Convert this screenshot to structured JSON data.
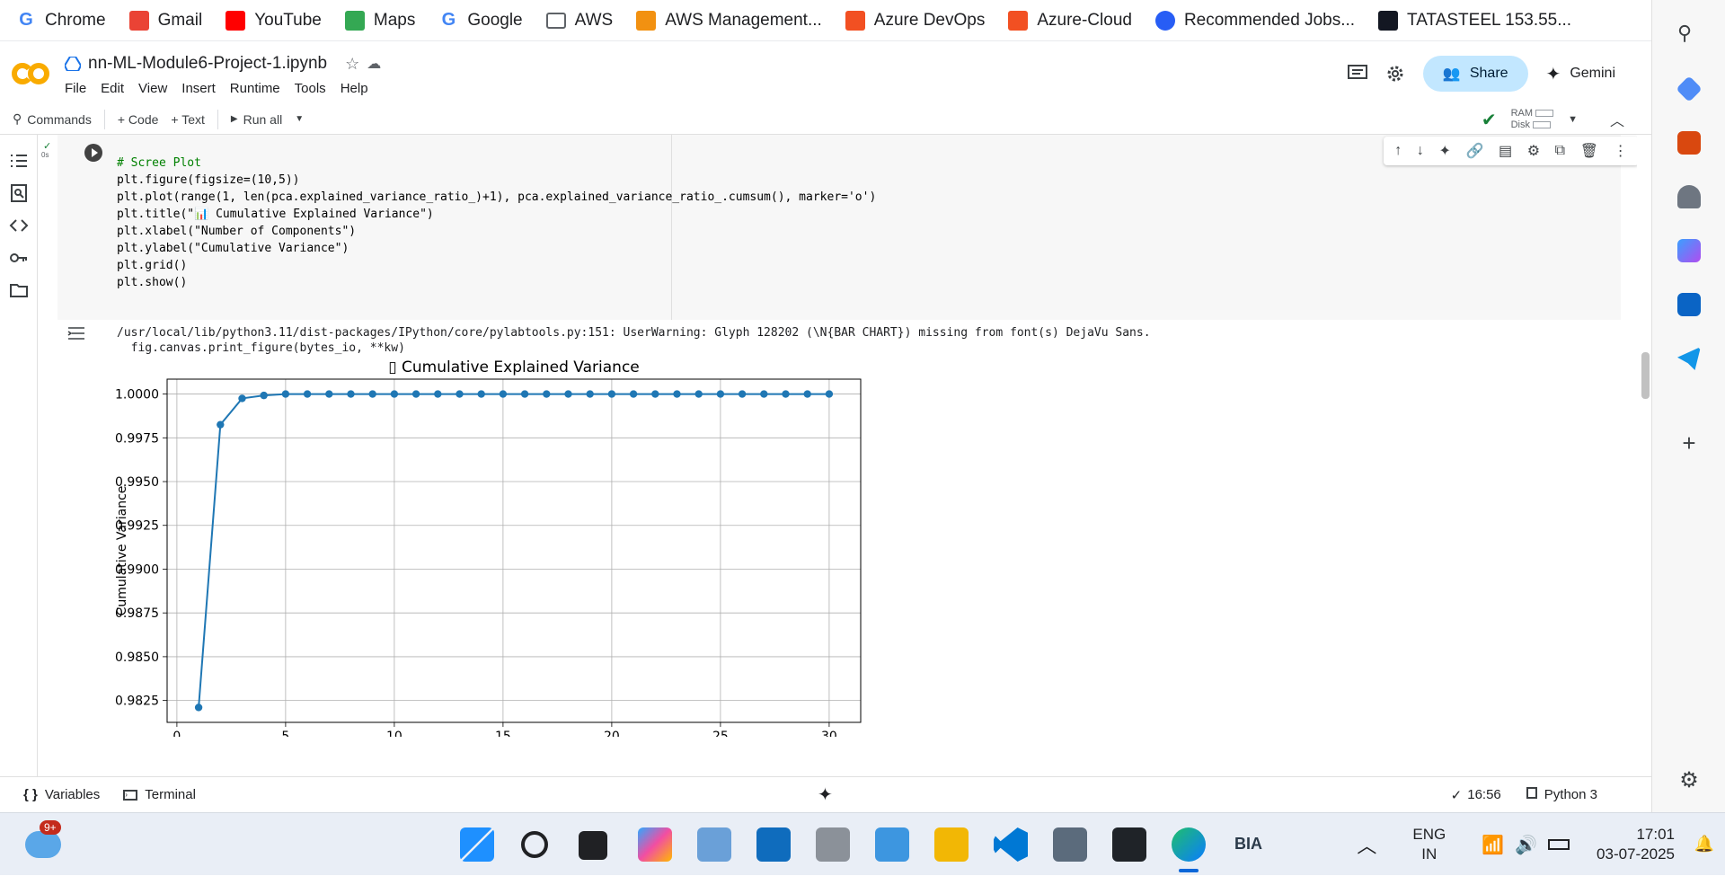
{
  "bookmarks": [
    {
      "label": "Chrome",
      "icon": "google-g-icon",
      "color": "#4285f4"
    },
    {
      "label": "Gmail",
      "icon": "gmail-icon",
      "color": "#ea4335"
    },
    {
      "label": "YouTube",
      "icon": "youtube-icon",
      "color": "#ff0000"
    },
    {
      "label": "Maps",
      "icon": "maps-icon",
      "color": "#34a853"
    },
    {
      "label": "Google",
      "icon": "google-g-icon",
      "color": "#4285f4"
    },
    {
      "label": "AWS",
      "icon": "folder-icon",
      "color": "#5f6368"
    },
    {
      "label": "AWS Management...",
      "icon": "aws-cube-icon",
      "color": "#f29111"
    },
    {
      "label": "Azure DevOps",
      "icon": "microsoft-icon",
      "color": "#f25022"
    },
    {
      "label": "Azure-Cloud",
      "icon": "microsoft-icon",
      "color": "#f25022"
    },
    {
      "label": "Recommended Jobs...",
      "icon": "naukri-icon",
      "color": "#275df5"
    },
    {
      "label": "TATASTEEL 153.55...",
      "icon": "tradingview-icon",
      "color": "#131722"
    }
  ],
  "header": {
    "notebook_title": "nn-ML-Module6-Project-1.ipynb",
    "menu": [
      "File",
      "Edit",
      "View",
      "Insert",
      "Runtime",
      "Tools",
      "Help"
    ],
    "share_label": "Share",
    "gemini_label": "Gemini"
  },
  "toolbar": {
    "commands_label": "Commands",
    "code_label": "+ Code",
    "text_label": "+ Text",
    "run_all_label": "Run all",
    "ram_label": "RAM",
    "disk_label": "Disk"
  },
  "cell": {
    "exec_time": "0s",
    "code_lines": [
      "# Scree Plot",
      "plt.figure(figsize=(10,5))",
      "plt.plot(range(1, len(pca.explained_variance_ratio_)+1), pca.explained_variance_ratio_.cumsum(), marker='o')",
      "plt.title(\"📊 Cumulative Explained Variance\")",
      "plt.xlabel(\"Number of Components\")",
      "plt.ylabel(\"Cumulative Variance\")",
      "plt.grid()",
      "plt.show()"
    ],
    "warning_line1": "/usr/local/lib/python3.11/dist-packages/IPython/core/pylabtools.py:151: UserWarning: Glyph 128202 (\\N{BAR CHART}) missing from font(s) DejaVu Sans.",
    "warning_line2": "  fig.canvas.print_figure(bytes_io, **kw)"
  },
  "chart_data": {
    "type": "line",
    "title": "▯ Cumulative Explained Variance",
    "xlabel": "Number of Components",
    "ylabel": "Cumulative Variance",
    "x": [
      1,
      2,
      3,
      4,
      5,
      6,
      7,
      8,
      9,
      10,
      11,
      12,
      13,
      14,
      15,
      16,
      17,
      18,
      19,
      20,
      21,
      22,
      23,
      24,
      25,
      26,
      27,
      28,
      29,
      30
    ],
    "values": [
      0.9821,
      0.99825,
      0.99975,
      0.99992,
      1.0,
      1.0,
      1.0,
      1.0,
      1.0,
      1.0,
      1.0,
      1.0,
      1.0,
      1.0,
      1.0,
      1.0,
      1.0,
      1.0,
      1.0,
      1.0,
      1.0,
      1.0,
      1.0,
      1.0,
      1.0,
      1.0,
      1.0,
      1.0,
      1.0,
      1.0
    ],
    "xlim": [
      -0.45,
      31.45
    ],
    "ylim": [
      0.98125,
      1.00085
    ],
    "xticks": [
      0,
      5,
      10,
      15,
      20,
      25,
      30
    ],
    "yticks": [
      "0.9825",
      "0.9850",
      "0.9875",
      "0.9900",
      "0.9925",
      "0.9950",
      "0.9975",
      "1.0000"
    ],
    "ytick_values": [
      0.9825,
      0.985,
      0.9875,
      0.99,
      0.9925,
      0.995,
      0.9975,
      1.0
    ],
    "grid": true,
    "marker": "o",
    "color": "#1f77b4"
  },
  "statusbar": {
    "variables_label": "Variables",
    "terminal_label": "Terminal",
    "time_label": "16:56",
    "kernel_label": "Python 3"
  },
  "taskbar": {
    "notification_badge": "9+",
    "bia_label": "BIA",
    "lang_line1": "ENG",
    "lang_line2": "IN",
    "time": "17:01",
    "date": "03-07-2025"
  },
  "colors": {
    "accent": "#1a73e8",
    "share_bg": "#c2e7ff",
    "colab_orange": "#f9ab00",
    "check_green": "#188038"
  }
}
